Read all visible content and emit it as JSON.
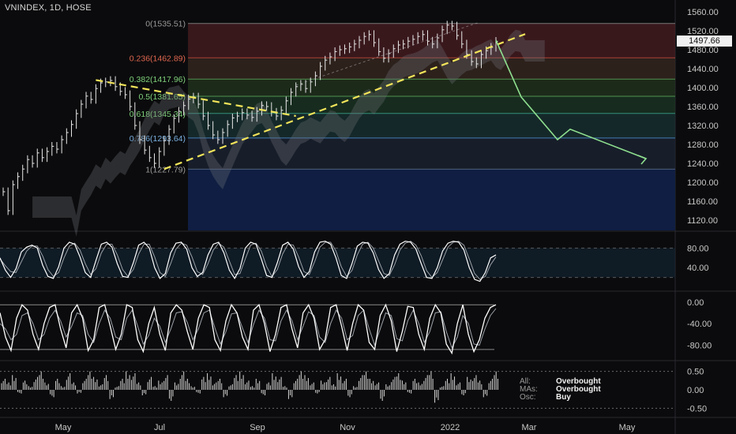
{
  "title": "VNINDEX, 1D, HOSE",
  "last_price": "1497.66",
  "colors": {
    "background": "#0b0b0d",
    "fib_text_red": "#e0674f",
    "fib_text_green": "#7fd17a",
    "fib_text_blue": "#7ab0e0",
    "trend_yellow": "#f2e45a",
    "projection_green": "#8fe08f",
    "stoch_fast": "#ffffff",
    "stoch_slow": "#9aa0a6"
  },
  "chart_data": [
    {
      "type": "line",
      "name": "price",
      "x_tick_labels": [
        "May",
        "Jul",
        "Sep",
        "Nov",
        "2022",
        "Mar",
        "May"
      ],
      "y_tick_labels": [
        "1560.00",
        "1520.00",
        "1480.00",
        "1440.00",
        "1400.00",
        "1360.00",
        "1320.00",
        "1280.00",
        "1240.00",
        "1200.00",
        "1160.00",
        "1120.00"
      ],
      "ylim": [
        1110,
        1575
      ],
      "fib_levels": [
        {
          "label": "0(1535.51)",
          "value": 1535.51
        },
        {
          "label": "0.236(1462.89)",
          "value": 1462.89
        },
        {
          "label": "0.382(1417.96)",
          "value": 1417.96
        },
        {
          "label": "0.5(1381.65)",
          "value": 1381.65
        },
        {
          "label": "0.618(1345.34)",
          "value": 1345.34
        },
        {
          "label": "0.786(1293.64)",
          "value": 1293.64
        },
        {
          "label": "1(1227.79)",
          "value": 1227.79
        }
      ],
      "close": [
        1180,
        1140,
        1195,
        1212,
        1228,
        1248,
        1240,
        1262,
        1252,
        1265,
        1276,
        1270,
        1290,
        1305,
        1322,
        1345,
        1365,
        1382,
        1375,
        1398,
        1410,
        1412,
        1415,
        1402,
        1392,
        1385,
        1360,
        1320,
        1290,
        1268,
        1252,
        1240,
        1265,
        1288,
        1312,
        1335,
        1350,
        1362,
        1376,
        1380,
        1365,
        1340,
        1320,
        1300,
        1290,
        1305,
        1322,
        1336,
        1340,
        1347,
        1342,
        1337,
        1350,
        1362,
        1360,
        1348,
        1340,
        1352,
        1372,
        1390,
        1402,
        1407,
        1398,
        1412,
        1425,
        1445,
        1458,
        1465,
        1476,
        1480,
        1482,
        1486,
        1492,
        1500,
        1508,
        1512,
        1495,
        1476,
        1462,
        1472,
        1482,
        1490,
        1492,
        1498,
        1502,
        1508,
        1512,
        1498,
        1492,
        1505,
        1522,
        1532,
        1530,
        1510,
        1492,
        1470,
        1455,
        1450,
        1470,
        1478,
        1485,
        1497.66
      ],
      "projection": [
        [
          1497.66,
          1500
        ],
        [
          1380,
          1520
        ],
        [
          1290,
          1545
        ],
        [
          1310,
          1558
        ],
        [
          1250,
          1605
        ]
      ],
      "note_projection": "x values of projection are bar indices; y values in price units"
    },
    {
      "type": "line",
      "name": "stochastic-rsi",
      "y_tick_labels": [
        "80.00",
        "40.00"
      ],
      "ylim": [
        0,
        100
      ],
      "k": [
        60,
        35,
        20,
        38,
        72,
        82,
        86,
        80,
        45,
        22,
        18,
        42,
        80,
        92,
        88,
        62,
        30,
        20,
        55,
        88,
        92,
        82,
        48,
        22,
        20,
        50,
        86,
        92,
        80,
        40,
        18,
        28,
        70,
        90,
        92,
        78,
        40,
        22,
        30,
        66,
        88,
        92,
        70,
        35,
        18,
        38,
        80,
        92,
        88,
        58,
        24,
        20,
        50,
        86,
        92,
        78,
        42,
        20,
        32,
        72,
        92,
        94,
        88,
        60,
        24,
        18,
        48,
        84,
        92,
        90,
        70,
        36,
        18,
        28,
        66,
        88,
        94,
        92,
        78,
        48,
        20,
        18,
        40,
        74,
        90,
        94,
        92,
        76,
        40,
        16,
        12,
        30,
        60,
        66
      ],
      "d": [
        58,
        44,
        32,
        30,
        52,
        74,
        84,
        84,
        64,
        36,
        22,
        30,
        60,
        84,
        90,
        76,
        48,
        26,
        38,
        70,
        88,
        88,
        66,
        36,
        22,
        36,
        68,
        88,
        88,
        62,
        30,
        22,
        48,
        78,
        90,
        86,
        62,
        32,
        26,
        48,
        76,
        90,
        82,
        54,
        26,
        28,
        58,
        86,
        90,
        74,
        42,
        22,
        36,
        68,
        88,
        86,
        62,
        32,
        26,
        52,
        82,
        92,
        92,
        74,
        42,
        22,
        34,
        66,
        88,
        92,
        80,
        54,
        28,
        24,
        46,
        76,
        90,
        94,
        86,
        64,
        34,
        20,
        30,
        56,
        82,
        92,
        94,
        86,
        58,
        28,
        16,
        22,
        46,
        62
      ]
    },
    {
      "type": "line",
      "name": "oscillator",
      "y_tick_labels": [
        "0.00",
        "-40.00",
        "-80.00"
      ],
      "ylim": [
        -100,
        10
      ],
      "fast": [
        -20,
        -65,
        -90,
        -30,
        -5,
        -15,
        -60,
        -88,
        -40,
        -10,
        -5,
        -50,
        -85,
        -20,
        -5,
        -30,
        -90,
        -70,
        -10,
        -5,
        -45,
        -88,
        -60,
        -5,
        -10,
        -70,
        -92,
        -40,
        -10,
        -60,
        -90,
        -20,
        -5,
        -15,
        -55,
        -88,
        -30,
        -5,
        -10,
        -70,
        -90,
        -35,
        -5,
        -20,
        -65,
        -88,
        -15,
        -5,
        -40,
        -92,
        -60,
        -10,
        -5,
        -50,
        -85,
        -20,
        -5,
        -30,
        -88,
        -70,
        -10,
        -5,
        -45,
        -90,
        -40,
        -5,
        -15,
        -75,
        -88,
        -25,
        -5,
        -35,
        -92,
        -55,
        -8,
        -10,
        -60,
        -88,
        -30,
        -5,
        -20,
        -78,
        -95,
        -40,
        -5,
        -60,
        -92,
        -70,
        -30,
        -10,
        -5
      ],
      "slow": [
        -40,
        -50,
        -70,
        -60,
        -25,
        -20,
        -40,
        -70,
        -60,
        -30,
        -15,
        -35,
        -65,
        -45,
        -20,
        -25,
        -60,
        -75,
        -40,
        -15,
        -30,
        -65,
        -70,
        -30,
        -15,
        -45,
        -78,
        -62,
        -30,
        -45,
        -75,
        -50,
        -20,
        -18,
        -38,
        -70,
        -50,
        -20,
        -15,
        -48,
        -78,
        -55,
        -22,
        -20,
        -48,
        -75,
        -42,
        -15,
        -30,
        -70,
        -72,
        -35,
        -15,
        -35,
        -70,
        -45,
        -18,
        -25,
        -65,
        -75,
        -40,
        -15,
        -30,
        -70,
        -62,
        -25,
        -15,
        -50,
        -80,
        -50,
        -20,
        -25,
        -68,
        -72,
        -35,
        -15,
        -40,
        -75,
        -55,
        -20,
        -18,
        -55,
        -85,
        -65,
        -25,
        -40,
        -78,
        -80,
        -50,
        -25,
        -12
      ]
    },
    {
      "type": "bar",
      "name": "technical-rating",
      "y_tick_labels": [
        "0.50",
        "0.00",
        "-0.50"
      ],
      "ylim": [
        -0.6,
        0.6
      ],
      "values": [
        0.3,
        0.2,
        0.4,
        -0.1,
        0.25,
        0.1,
        0.35,
        0.5,
        0.2,
        -0.2,
        0.3,
        0.1,
        0.45,
        0.2,
        -0.1,
        0.3,
        0.5,
        0.35,
        0.15,
        0.4,
        -0.25,
        0.1,
        0.3,
        0.5,
        0.45,
        0.2,
        -0.15,
        0.35,
        0.1,
        0.25,
        0.4,
        -0.3,
        0.2,
        0.5,
        0.3,
        0.1,
        -0.1,
        0.35,
        0.45,
        0.2,
        0.3,
        -0.2,
        0.15,
        0.4,
        0.5,
        0.25,
        0.1,
        0.3,
        -0.15,
        0.2,
        0.45,
        0.35,
        0.1,
        -0.25,
        0.3,
        0.5,
        0.4,
        0.2,
        -0.1,
        0.25,
        0.35,
        0.15,
        0.45,
        0.3,
        -0.2,
        0.1,
        0.4,
        0.5,
        0.3,
        0.2,
        -0.3,
        0.15,
        0.35,
        0.45,
        0.25,
        -0.1,
        0.3,
        0.2,
        0.4,
        0.5,
        -0.35,
        0.1,
        0.3,
        0.45,
        0.2,
        -0.15,
        0.35,
        0.4,
        0.25,
        -0.2,
        0.3,
        0.5
      ]
    }
  ],
  "ratings": [
    {
      "key": "All:",
      "value": "Overbought"
    },
    {
      "key": "MAs:",
      "value": "Overbought"
    },
    {
      "key": "Osc:",
      "value": "Buy"
    }
  ]
}
